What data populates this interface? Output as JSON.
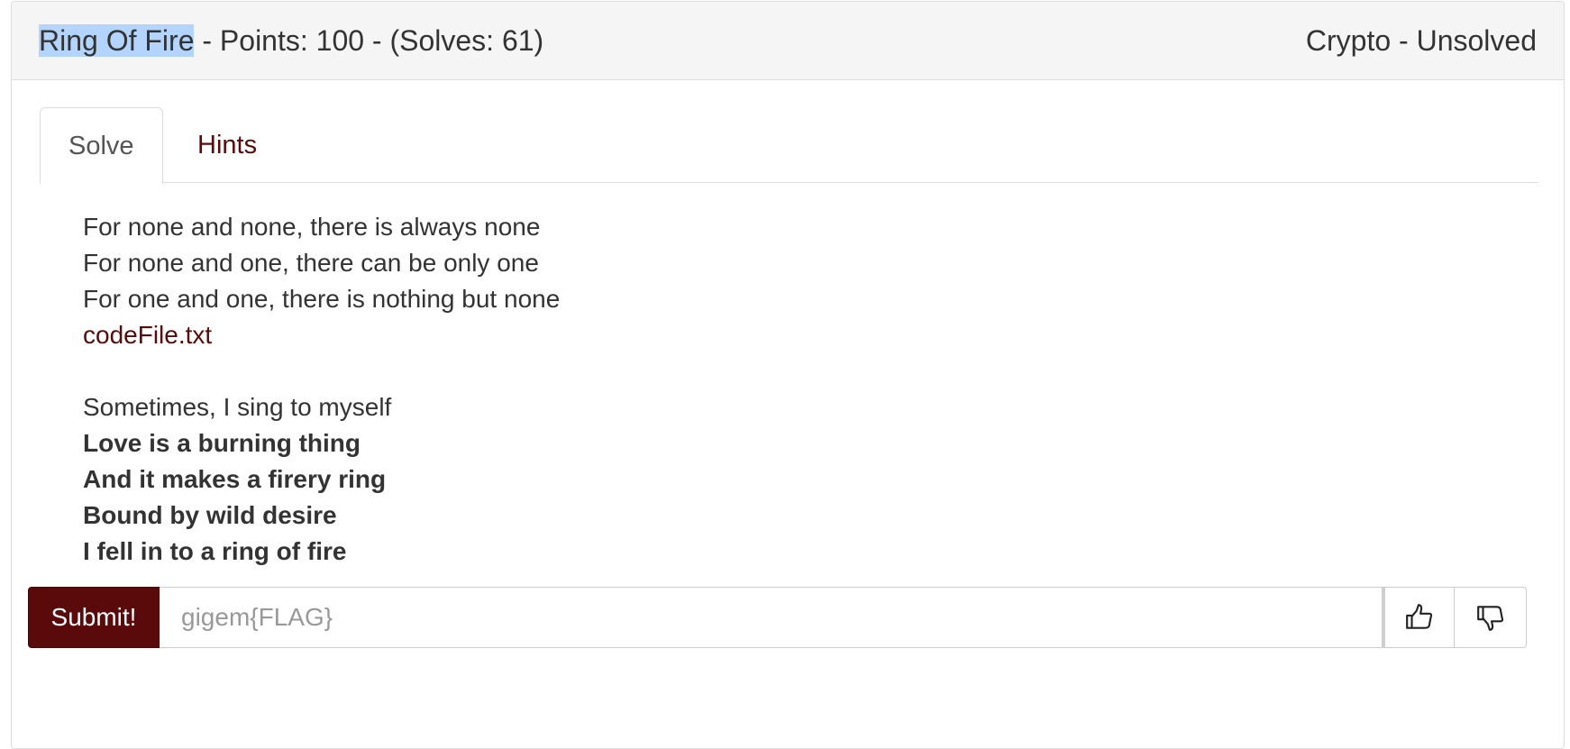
{
  "header": {
    "challenge_title": "Ring Of Fire",
    "meta": " - Points: 100 - (Solves: 61)",
    "category_status": "Crypto - Unsolved"
  },
  "tabs": [
    {
      "label": "Solve",
      "active": true
    },
    {
      "label": "Hints",
      "active": false
    }
  ],
  "description": {
    "lines": [
      "For none and none, there is always none",
      "For none and one, there can be only one",
      "For one and one, there is nothing but none"
    ],
    "file_link": "codeFile.txt",
    "intro": "Sometimes, I sing to myself",
    "lyrics": [
      "Love is a burning thing",
      "And it makes a firery ring",
      "Bound by wild desire",
      "I fell in to a ring of fire"
    ]
  },
  "flag_form": {
    "submit_label": "Submit!",
    "placeholder": "gigem{FLAG}",
    "value": ""
  },
  "icons": {
    "upvote": "thumbs-up-icon",
    "downvote": "thumbs-down-icon"
  },
  "colors": {
    "accent": "#5a0a0a",
    "heading_bg": "#f5f5f5",
    "selection": "#b3d4fc"
  }
}
